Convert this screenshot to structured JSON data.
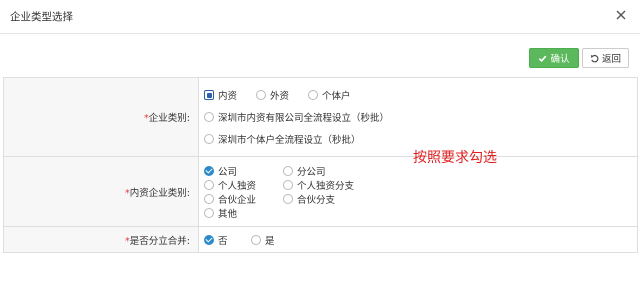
{
  "dialog": {
    "title": "企业类型选择",
    "close_icon": "close-icon"
  },
  "toolbar": {
    "confirm_label": "确认",
    "confirm_icon": "check-icon",
    "back_label": "返回",
    "back_icon": "undo-icon"
  },
  "colors": {
    "confirm_bg": "#5cb85c",
    "checked": "#2c8ac9",
    "required": "#e4393c",
    "annotation": "#e02020"
  },
  "form": {
    "enterprise_category": {
      "required_mark": "*",
      "label": "企业类别:",
      "options": [
        {
          "label": "内资",
          "checked": true
        },
        {
          "label": "外资",
          "checked": false
        },
        {
          "label": "个体户",
          "checked": false
        },
        {
          "label": "深圳市内资有限公司全流程设立（秒批）",
          "checked": false
        },
        {
          "label": "深圳市个体户全流程设立（秒批）",
          "checked": false
        }
      ]
    },
    "domestic_category": {
      "required_mark": "*",
      "label": "内资企业类别:",
      "options": [
        {
          "label": "公司",
          "checked": true
        },
        {
          "label": "分公司",
          "checked": false
        },
        {
          "label": "个人独资",
          "checked": false
        },
        {
          "label": "个人独资分支",
          "checked": false
        },
        {
          "label": "合伙企业",
          "checked": false
        },
        {
          "label": "合伙分支",
          "checked": false
        },
        {
          "label": "其他",
          "checked": false
        }
      ]
    },
    "branch_merge": {
      "required_mark": "*",
      "label": "是否分立合并:",
      "options": [
        {
          "label": "否",
          "checked": true
        },
        {
          "label": "是",
          "checked": false
        }
      ]
    }
  },
  "annotation": "按照要求勾选"
}
